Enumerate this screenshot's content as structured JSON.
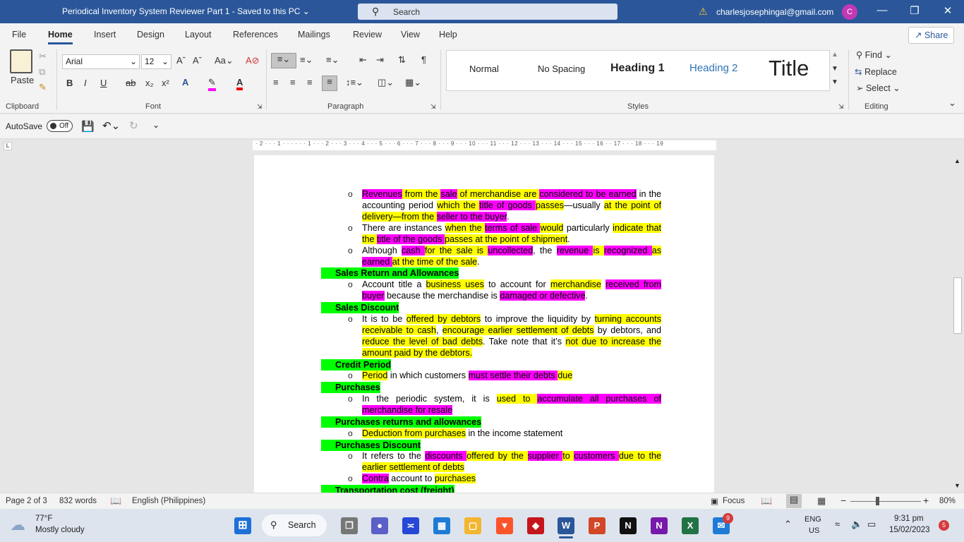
{
  "titlebar": {
    "doc_title": "Periodical Inventory System Reviewer Part 1  -  Saved to this PC  ⌄",
    "search_placeholder": "Search",
    "account": "charlesjosephingal@gmail.com",
    "avatar_initial": "C"
  },
  "menu": [
    "File",
    "Home",
    "Insert",
    "Design",
    "Layout",
    "References",
    "Mailings",
    "Review",
    "View",
    "Help"
  ],
  "share_label": "Share",
  "ribbon": {
    "paste_label": "Paste",
    "font_name": "Arial",
    "font_size": "12",
    "groups": {
      "clipboard": "Clipboard",
      "font": "Font",
      "paragraph": "Paragraph",
      "styles": "Styles",
      "editing": "Editing"
    },
    "styles": [
      "Normal",
      "No Spacing",
      "Heading 1",
      "Heading 2",
      "Title"
    ],
    "editing": {
      "find": "Find",
      "replace": "Replace",
      "select": "Select"
    }
  },
  "qat": {
    "autosave": "AutoSave",
    "toggle": "Off"
  },
  "ruler_text": "· 2 · · · 1 · · ·  · · · 1 · · · 2 · · · 3 · · · 4 · · · 5 · · · 6 · · · 7 · · · 8 · · · 9 · · · 10 · · · 11 · · · 12 · · · 13 · · · 14 · · · 15 · · · 16 · · 17 · · · 18 · · · 19",
  "document": {
    "p1": [
      "Revenues",
      " from the ",
      "sale",
      " of merchandise are ",
      "considered to be earned",
      " in the"
    ],
    "p1b": [
      "accounting period ",
      "which the ",
      "title of goods ",
      "passes",
      "—usually ",
      "at the point of"
    ],
    "p1c": [
      "delivery—from the ",
      "seller to the buyer",
      "."
    ],
    "p2": [
      "There are instances ",
      "when the ",
      "terms of sale ",
      "would",
      " particularly ",
      "indicate that"
    ],
    "p2b": [
      "the ",
      "title of the goods ",
      "passes at the point of shipment",
      "."
    ],
    "p3": [
      "Although ",
      "cash ",
      "for the sale is ",
      "uncollected",
      ", the ",
      "revenue ",
      "is ",
      "recognized ",
      "as"
    ],
    "p3b": [
      "earned ",
      "at the time of the sale",
      "."
    ],
    "h1": "Sales Return and Allowances",
    "p4": [
      "Account title a ",
      "business uses",
      " to account for ",
      "merchandise",
      " ",
      "received from"
    ],
    "p4b": [
      "buyer",
      " because the merchandise is ",
      "damaged or defective",
      "."
    ],
    "h2": "Sales Discount",
    "p5": [
      "It is to be ",
      "offered by debtors",
      " to improve the liquidity by ",
      "turning accounts"
    ],
    "p5b": [
      "receivable to cash",
      ", ",
      "encourage earlier settlement of debts",
      " by debtors, and"
    ],
    "p5c": [
      "reduce the level of bad debts",
      ". Take note that it’s ",
      "not due to increase the"
    ],
    "p5d": [
      "amount paid by the debtors."
    ],
    "h3": "Credit Period",
    "p6": [
      "Period",
      " in which customers ",
      "must settle their debts ",
      "due"
    ],
    "h4": "Purchases",
    "p7": [
      "In the periodic system, it is ",
      "used to ",
      "accumulate all purchases of"
    ],
    "p7b": [
      "merchandise for resale"
    ],
    "h5": "Purchases returns and allowances",
    "p8": [
      "Deduction from purchases",
      " in the income statement"
    ],
    "h6": "Purchases Discount",
    "p9": [
      "It refers to the ",
      "discounts ",
      "offered by the ",
      "supplier ",
      "to ",
      "customers ",
      "due to the"
    ],
    "p9b": [
      "earlier settlement of debts"
    ],
    "p10": [
      "Contra",
      " account to ",
      "purchases"
    ],
    "h7": "Transportation cost (freight)"
  },
  "status": {
    "page": "Page 2 of 3",
    "words": "832 words",
    "language": "English (Philippines)",
    "focus": "Focus",
    "zoom": "80%"
  },
  "taskbar": {
    "temp": "77°F",
    "weather": "Mostly cloudy",
    "search": "Search",
    "lang1": "ENG",
    "lang2": "US",
    "time": "9:31 pm",
    "date": "15/02/2023",
    "notif": "5",
    "badge": "9"
  }
}
